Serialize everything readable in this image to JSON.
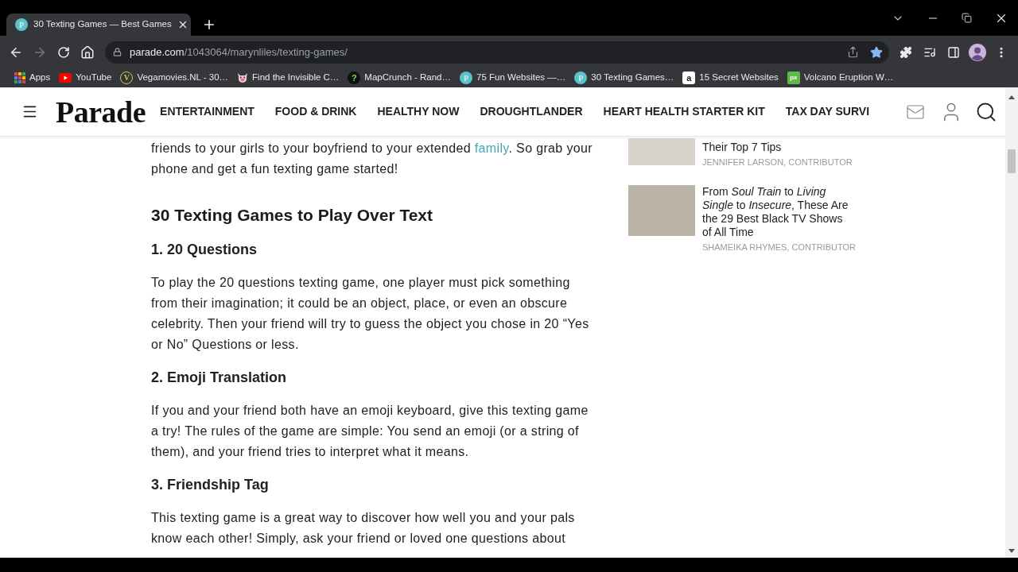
{
  "browser": {
    "tabs": [
      {
        "title": "30 Texting Games — Best Games",
        "favicon_text": "P",
        "selected": true
      }
    ],
    "toolbar": {
      "back": {
        "disabled": false
      },
      "forward": {
        "disabled": true
      }
    },
    "address": {
      "domain": "parade.com",
      "path": "/1043064/marynliles/texting-games/",
      "bookmarked": true
    },
    "bookmarks": [
      {
        "label": "Apps",
        "kind": "apps"
      },
      {
        "label": "YouTube",
        "kind": "youtube"
      },
      {
        "label": "Vegamovies.NL - 30…",
        "kind": "outline-letter",
        "icon_text": "V"
      },
      {
        "label": "Find the Invisible C…",
        "kind": "pig"
      },
      {
        "label": "MapCrunch - Rand…",
        "kind": "dark-circle-letter",
        "icon_text": "?"
      },
      {
        "label": "75 Fun Websites —…",
        "kind": "circle-letter",
        "icon_text": "P"
      },
      {
        "label": "30 Texting Games…",
        "kind": "circle-letter",
        "icon_text": "P"
      },
      {
        "label": "15 Secret Websites",
        "kind": "square-letter",
        "icon_text": "a"
      },
      {
        "label": "Volcano Eruption W…",
        "kind": "green-square-letter",
        "icon_text": "px"
      }
    ]
  },
  "site_header": {
    "logo": "Parade",
    "nav_links": [
      "ENTERTAINMENT",
      "FOOD & DRINK",
      "HEALTHY NOW",
      "DROUGHTLANDER",
      "HEART HEALTH STARTER KIT",
      "TAX DAY SURVI"
    ]
  },
  "article": {
    "blocks": [
      {
        "kind": "paragraph",
        "segments": [
          {
            "kind": "text",
            "text": "friends to your girls to your boyfriend to your extended "
          },
          {
            "kind": "link",
            "text": "family"
          },
          {
            "kind": "text",
            "text": ". So grab your phone and get a fun texting game started!"
          }
        ]
      },
      {
        "kind": "h2",
        "text": "30 Texting Games to Play Over Text"
      },
      {
        "kind": "h3",
        "text": "1. 20 Questions"
      },
      {
        "kind": "paragraph",
        "segments": [
          {
            "kind": "text",
            "text": "To play the 20 questions texting game, one player must pick something from their imagination; it could be an object, place, or even an obscure celebrity. Then your friend will try to guess the object you chose in 20 “Yes or No” Questions or less."
          }
        ]
      },
      {
        "kind": "h3",
        "text": "2. Emoji Translation"
      },
      {
        "kind": "paragraph",
        "segments": [
          {
            "kind": "text",
            "text": "If you and your friend both have an emoji keyboard, give this texting game a try! The rules of the game are simple: You send an emoji (or a string of them), and your friend tries to interpret what it means."
          }
        ]
      },
      {
        "kind": "h3",
        "text": "3. Friendship Tag"
      },
      {
        "kind": "paragraph",
        "segments": [
          {
            "kind": "text",
            "text": "This texting game is a great way to discover how well you and your pals know each other! Simply, ask your friend or loved one questions about"
          }
        ]
      }
    ]
  },
  "sidebar": {
    "stories": [
      {
        "title": "Their Top 7 Tips",
        "author": "JENNIFER LARSON, CONTRIBUTOR"
      },
      {
        "title": "From *Soul Train* to *Living Single* to *Insecure*, These Are the 29 Best Black TV Shows of All Time",
        "author": "SHAMEIKA RHYMES, CONTRIBUTOR"
      }
    ]
  }
}
